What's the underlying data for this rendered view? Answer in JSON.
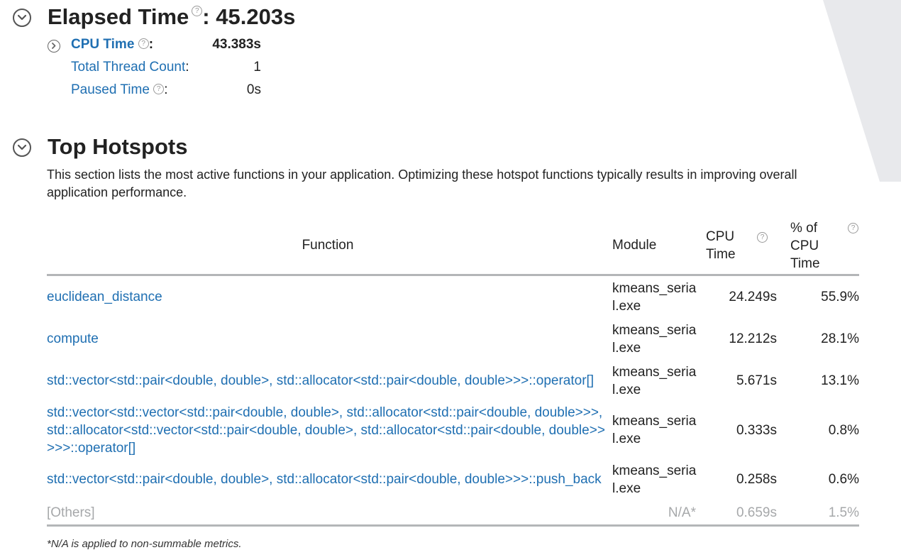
{
  "elapsed": {
    "title": "Elapsed Time",
    "separator": ":",
    "value": "45.203s"
  },
  "metrics": [
    {
      "label": "CPU Time",
      "suffix": ":",
      "value": "43.383s"
    },
    {
      "label": "Total Thread Count",
      "suffix": ":",
      "value": "1"
    },
    {
      "label": "Paused Time",
      "suffix": ":",
      "value": "0s"
    }
  ],
  "hotspots": {
    "title": "Top Hotspots",
    "description": "This section lists the most active functions in your application. Optimizing these hotspot functions typically results in improving overall application performance.",
    "columns": {
      "function": "Function",
      "module": "Module",
      "cpu_time": "CPU Time",
      "pct_cpu_time": "% of CPU Time"
    },
    "rows": [
      {
        "function": "euclidean_distance",
        "module": "kmeans_serial.exe",
        "cpu_time": "24.249s",
        "pct": "55.9%"
      },
      {
        "function": "compute",
        "module": "kmeans_serial.exe",
        "cpu_time": "12.212s",
        "pct": "28.1%"
      },
      {
        "function": "std::vector<std::pair<double, double>, std::allocator<std::pair<double, double>>>::operator[]",
        "module": "kmeans_serial.exe",
        "cpu_time": "5.671s",
        "pct": "13.1%"
      },
      {
        "function": "std::vector<std::vector<std::pair<double, double>, std::allocator<std::pair<double, double>>>, std::allocator<std::vector<std::pair<double, double>, std::allocator<std::pair<double, double>>>>>::operator[]",
        "module": "kmeans_serial.exe",
        "cpu_time": "0.333s",
        "pct": "0.8%"
      },
      {
        "function": "std::vector<std::pair<double, double>, std::allocator<std::pair<double, double>>>::push_back",
        "module": "kmeans_serial.exe",
        "cpu_time": "0.258s",
        "pct": "0.6%"
      }
    ],
    "others": {
      "function": "[Others]",
      "module": "N/A*",
      "cpu_time": "0.659s",
      "pct": "1.5%"
    },
    "footnote": "*N/A is applied to non-summable metrics."
  },
  "help_glyph": "?",
  "colors": {
    "link": "#1f6fb2",
    "muted": "#a6a8aa",
    "rule": "#b4b6b8"
  }
}
